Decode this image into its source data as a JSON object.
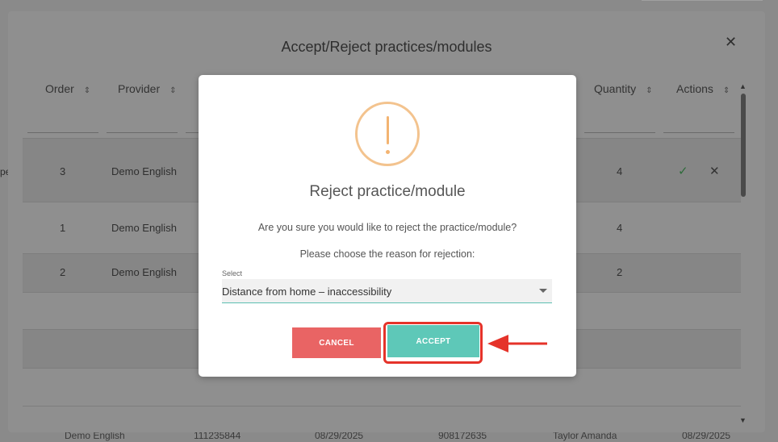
{
  "outer_modal": {
    "title": "Accept/Reject practices/modules",
    "columns": {
      "order": "Order",
      "provider": "Provider",
      "quantity": "Quantity",
      "actions": "Actions"
    },
    "rows": [
      {
        "order": "3",
        "provider": "Demo English",
        "quantity": "4"
      },
      {
        "order": "1",
        "provider": "Demo English",
        "quantity": "4"
      },
      {
        "order": "2",
        "provider": "Demo English",
        "quantity": "2"
      }
    ]
  },
  "background": {
    "footer_cells": [
      "Demo English",
      "111235844",
      "08/29/2025",
      "908172635",
      "Taylor Amanda",
      "08/29/2025"
    ],
    "edge_text": "pe"
  },
  "dialog": {
    "title": "Reject practice/module",
    "message": "Are you sure you would like to reject the practice/module?",
    "reason_prompt": "Please choose the reason for rejection:",
    "select": {
      "label": "Select",
      "value": "Distance from home – inaccessibility"
    },
    "cancel_label": "CANCEL",
    "accept_label": "ACCEPT"
  },
  "icons": {
    "warning": "warning-exclamation-icon",
    "close": "close-icon",
    "sort": "sort-icon",
    "approve": "check-icon",
    "reject": "x-icon",
    "dropdown": "chevron-down-icon",
    "annotation_arrow": "arrow-left-icon"
  },
  "colors": {
    "cancel": "#e96464",
    "accept": "#5ec8b8",
    "warning": "#f3c38e",
    "highlight": "#e5332a",
    "approve": "#2e6b3a"
  }
}
